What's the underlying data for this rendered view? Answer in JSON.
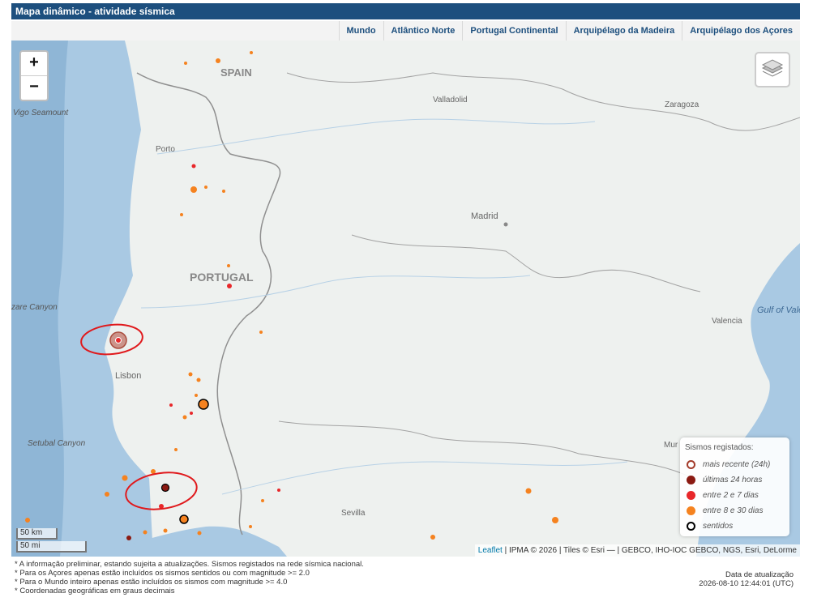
{
  "app": {
    "title": "Mapa dinâmico - atividade sísmica"
  },
  "tabs": [
    {
      "label": "Mundo"
    },
    {
      "label": "Atlântico Norte"
    },
    {
      "label": "Portugal Continental"
    },
    {
      "label": "Arquipélago da Madeira"
    },
    {
      "label": "Arquipélago dos Açores"
    }
  ],
  "map": {
    "zoom_in": "+",
    "zoom_out": "−",
    "labels": {
      "spain": "SPAIN",
      "portugal": "PORTUGAL",
      "vigo": "Vigo Seamount",
      "porto": "Porto",
      "valladolid": "Valladolid",
      "zaragoza": "Zaragoza",
      "madrid": "Madrid",
      "lisbon": "Lisbon",
      "sevilla": "Sevilla",
      "valencia": "Valencia",
      "gulf": "Gulf of Valenci",
      "nazare": "zare Canyon",
      "setubal": "Setubal Canyon",
      "murcia": "Mur"
    },
    "colors": {
      "land": "#eef1ef",
      "sea": "#a9c9e3",
      "border": "#8f8f8f",
      "recent_24h": "#a33b2a",
      "last_24h": "#8b1a12",
      "days_2_7": "#e8272a",
      "days_8_30": "#f5821f",
      "felt_ring": "#000000",
      "annotation": "#e0191c"
    }
  },
  "legend": {
    "title": "Sismos registados:",
    "items": [
      {
        "label": "mais recente (24h)"
      },
      {
        "label": "últimas 24 horas"
      },
      {
        "label": "entre 2 e 7 dias"
      },
      {
        "label": "entre 8 e 30 dias"
      },
      {
        "label": "sentidos"
      }
    ]
  },
  "scale": {
    "km": "50 km",
    "mi": "50 mi"
  },
  "attribution": {
    "leaflet": "Leaflet",
    "text": " | IPMA © 2026 | Tiles © Esri — | GEBCO, IHO-IOC GEBCO, NGS, Esri, DeLorme"
  },
  "notes": [
    "* A informação preliminar, estando sujeita a atualizações. Sismos registados na rede sísmica nacional.",
    "* Para os Açores apenas estão incluídos os sismos sentidos ou com magnitude >= 2.0",
    "* Para o Mundo inteiro apenas estão incluídos os sismos com magnitude >= 4.0",
    "* Coordenadas geográficas em graus decimais"
  ],
  "update": {
    "label": "Data de atualização",
    "value": "2026-08-10 12:44:01 (UTC)"
  }
}
